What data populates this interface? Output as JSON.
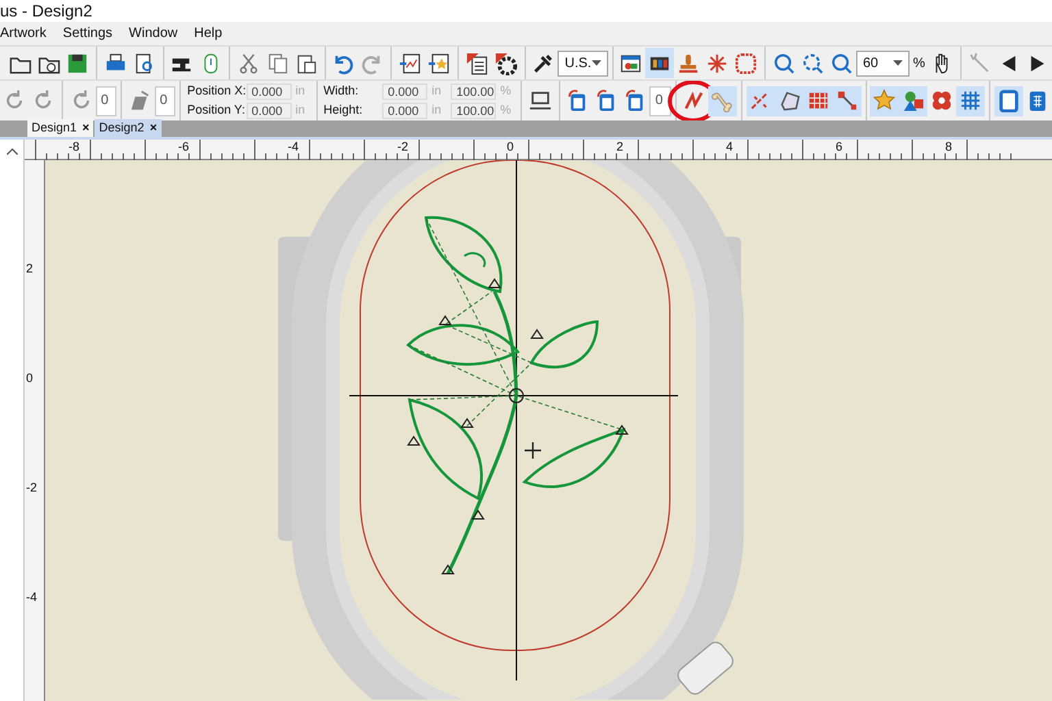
{
  "window": {
    "title": "us - Design2"
  },
  "menu": [
    "Artwork",
    "Settings",
    "Window",
    "Help"
  ],
  "toolbar_1": [
    {
      "kind": "icon",
      "pressed": false
    },
    {
      "kind": "icon",
      "pressed": false
    },
    {
      "kind": "icon",
      "pressed": false
    },
    {
      "kind": "sep"
    },
    {
      "kind": "icon",
      "pressed": false
    },
    {
      "kind": "icon",
      "pressed": false
    },
    {
      "kind": "sep"
    },
    {
      "kind": "icon",
      "pressed": false
    },
    {
      "kind": "icon",
      "pressed": false
    },
    {
      "kind": "sep"
    },
    {
      "kind": "icon",
      "pressed": false
    },
    {
      "kind": "icon",
      "pressed": false
    },
    {
      "kind": "icon",
      "pressed": false
    },
    {
      "kind": "sep"
    },
    {
      "kind": "icon",
      "pressed": false
    },
    {
      "kind": "icon",
      "pressed": false
    },
    {
      "kind": "sep"
    },
    {
      "kind": "icon",
      "pressed": false
    },
    {
      "kind": "icon",
      "pressed": false
    },
    {
      "kind": "sep"
    },
    {
      "kind": "icon",
      "pressed": false
    },
    {
      "kind": "icon",
      "pressed": false
    },
    {
      "kind": "sep"
    },
    {
      "kind": "icon",
      "pressed": false
    },
    {
      "kind": "dropdown",
      "value": "U.S."
    },
    {
      "kind": "sep"
    },
    {
      "kind": "icon",
      "pressed": false
    },
    {
      "kind": "icon",
      "pressed": true
    },
    {
      "kind": "icon",
      "pressed": false
    },
    {
      "kind": "icon",
      "pressed": false
    },
    {
      "kind": "icon",
      "pressed": false
    },
    {
      "kind": "sep"
    },
    {
      "kind": "icon",
      "pressed": false
    },
    {
      "kind": "icon",
      "pressed": false
    },
    {
      "kind": "icon",
      "pressed": false
    },
    {
      "kind": "dropdown",
      "value": "60"
    },
    {
      "kind": "label",
      "text": "%"
    },
    {
      "kind": "icon",
      "pressed": false
    },
    {
      "kind": "sep"
    },
    {
      "kind": "icon",
      "pressed": false
    },
    {
      "kind": "icon",
      "pressed": false
    },
    {
      "kind": "icon",
      "pressed": false
    }
  ],
  "toolbar_2": [
    {
      "kind": "icon",
      "pressed": false
    },
    {
      "kind": "icon",
      "pressed": false
    },
    {
      "kind": "sep"
    },
    {
      "kind": "icon",
      "pressed": false
    },
    {
      "kind": "field",
      "value": "0"
    },
    {
      "kind": "sep"
    },
    {
      "kind": "icon",
      "pressed": false
    },
    {
      "kind": "field",
      "value": "0"
    },
    {
      "kind": "sep"
    },
    {
      "kind": "stack",
      "rows": [
        {
          "label": "Position X:",
          "value": "0.000",
          "unit": "in"
        },
        {
          "label": "Position Y:",
          "value": "0.000",
          "unit": "in"
        }
      ]
    },
    {
      "kind": "sep"
    },
    {
      "kind": "stack",
      "rows": [
        {
          "label": "Width:",
          "value": "0.000",
          "unit": "in"
        },
        {
          "label": "Height:",
          "value": "0.000",
          "unit": "in"
        }
      ]
    },
    {
      "kind": "stack",
      "rows": [
        {
          "value": "100.00",
          "unit": "%"
        },
        {
          "value": "100.00",
          "unit": "%"
        }
      ]
    },
    {
      "kind": "sep"
    },
    {
      "kind": "icon",
      "pressed": false
    },
    {
      "kind": "sep"
    },
    {
      "kind": "icon",
      "pressed": false
    },
    {
      "kind": "icon",
      "pressed": false
    },
    {
      "kind": "icon",
      "pressed": false
    },
    {
      "kind": "field",
      "value": "0"
    },
    {
      "kind": "sep"
    },
    {
      "kind": "icon",
      "pressed": false,
      "circled": true
    },
    {
      "kind": "icon",
      "pressed": true
    },
    {
      "kind": "sep"
    },
    {
      "kind": "icon",
      "pressed": true
    },
    {
      "kind": "icon",
      "pressed": true
    },
    {
      "kind": "icon",
      "pressed": true
    },
    {
      "kind": "icon",
      "pressed": true
    },
    {
      "kind": "sep"
    },
    {
      "kind": "icon",
      "pressed": true
    },
    {
      "kind": "icon",
      "pressed": true
    },
    {
      "kind": "icon",
      "pressed": false
    },
    {
      "kind": "icon",
      "pressed": true
    },
    {
      "kind": "sep"
    },
    {
      "kind": "icon",
      "pressed": true
    },
    {
      "kind": "icon",
      "pressed": false
    }
  ],
  "tabs": [
    {
      "label": "Design1",
      "selected": false,
      "close": "×"
    },
    {
      "label": "Design2",
      "selected": true,
      "close": "×"
    }
  ],
  "ruler": {
    "horizontal": [
      "-8",
      "-6",
      "-4",
      "-2",
      "0",
      "2",
      "4",
      "6",
      "8"
    ],
    "vertical": [
      "2",
      "0",
      "-2",
      "-4"
    ]
  }
}
